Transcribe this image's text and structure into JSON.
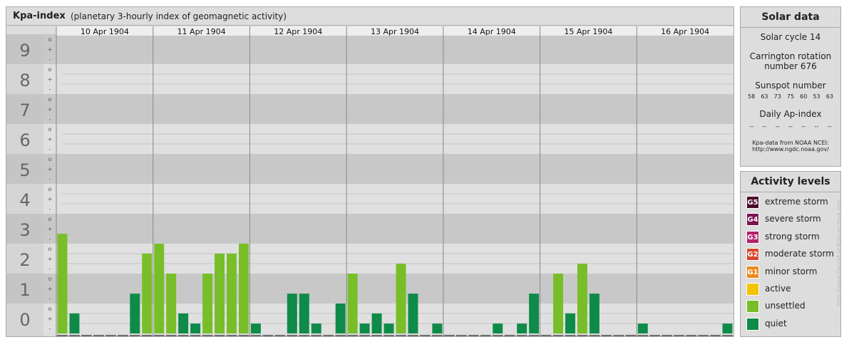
{
  "header": {
    "title": "Kpa-index",
    "subtitle": "(planetary 3-hourly index of geomagnetic activity)"
  },
  "chart_data": {
    "type": "bar",
    "title": "Kpa-index",
    "subtitle": "(planetary 3-hourly index of geomagnetic activity)",
    "ylim": [
      0,
      9
    ],
    "y_major_ticks": [
      "0",
      "1",
      "2",
      "3",
      "4",
      "5",
      "6",
      "7",
      "8",
      "9"
    ],
    "y_minor_labels": [
      "o",
      "+",
      "-"
    ],
    "days": [
      "10 Apr 1904",
      "11 Apr 1904",
      "12 Apr 1904",
      "13 Apr 1904",
      "14 Apr 1904",
      "15 Apr 1904",
      "16 Apr 1904"
    ],
    "intervals": [
      [
        "0",
        "3"
      ],
      [
        "3",
        "6"
      ],
      [
        "6",
        "9"
      ],
      [
        "9",
        "12"
      ],
      [
        "12",
        "15"
      ],
      [
        "15",
        "18"
      ],
      [
        "18",
        "21"
      ],
      [
        "21",
        "24"
      ]
    ],
    "values": [
      3.33,
      0.67,
      0,
      0,
      0,
      0,
      1.33,
      2.67,
      3.0,
      2.0,
      0.67,
      0.33,
      2.0,
      2.67,
      2.67,
      3.0,
      0.33,
      0,
      0,
      1.33,
      1.33,
      0.33,
      0,
      1.0,
      2.0,
      0.33,
      0.67,
      0.33,
      2.33,
      1.33,
      0,
      0.33,
      0,
      0,
      0,
      0,
      0.33,
      0,
      0.33,
      1.33,
      0,
      2.0,
      0.67,
      2.33,
      1.33,
      0,
      0,
      0,
      0.33,
      0,
      0,
      0,
      0,
      0,
      0,
      0.33
    ],
    "colors": {
      "quiet": "#0e8b48",
      "unsettled": "#78be29",
      "active": "#f4c400",
      "band_dark": "#c8c8c8",
      "band_light": "#e0e0e0"
    }
  },
  "solar": {
    "title": "Solar data",
    "cycle": "Solar cycle 14",
    "carrington_line1": "Carrington rotation",
    "carrington_line2": "number 676",
    "sunspot_title": "Sunspot number",
    "sunspots": [
      "58",
      "63",
      "73",
      "75",
      "60",
      "53",
      "63"
    ],
    "ap_title": "Daily Ap-index",
    "ap_values": [
      "--",
      "--",
      "--",
      "--",
      "--",
      "--",
      "--"
    ],
    "source_line1": "Kpa-data from NOAA NCEI:",
    "source_line2": "http://www.ngdc.noaa.gov/"
  },
  "activity": {
    "title": "Activity levels",
    "levels": [
      {
        "badge": "G5",
        "label": "extreme storm",
        "color": "#4a0a2c"
      },
      {
        "badge": "G4",
        "label": "severe storm",
        "color": "#7a1452"
      },
      {
        "badge": "G3",
        "label": "strong storm",
        "color": "#b3206e"
      },
      {
        "badge": "G2",
        "label": "moderate storm",
        "color": "#d7462a"
      },
      {
        "badge": "G1",
        "label": "minor storm",
        "color": "#ea8a1c"
      },
      {
        "badge": "",
        "label": "active",
        "color": "#f4c400"
      },
      {
        "badge": "",
        "label": "unsettled",
        "color": "#78be29"
      },
      {
        "badge": "",
        "label": "quiet",
        "color": "#0e8b48"
      }
    ]
  },
  "credit": "http://www.fleuret.at/kpa-archive.php"
}
